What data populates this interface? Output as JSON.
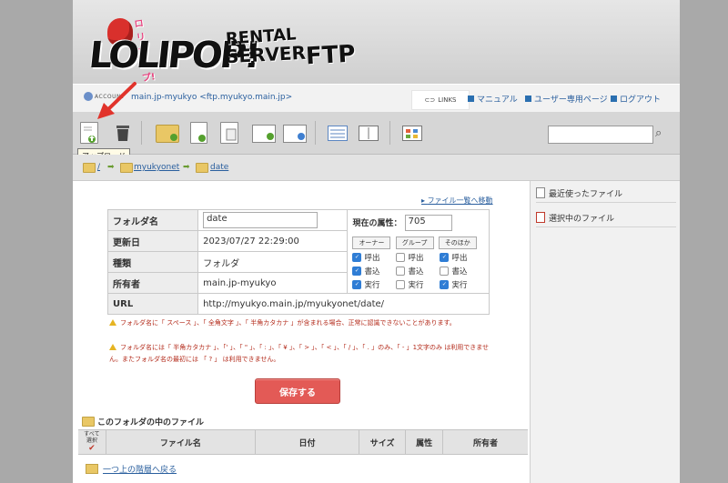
{
  "header": {
    "logo_tag": "ロリポップ!レンタルサーバー",
    "logo_main": "LOLIPOP!",
    "logo_rental": "RENTAL",
    "logo_server": "SERVER",
    "logo_ftp": "FTP"
  },
  "account": {
    "label": "ACCOUNT",
    "name": "main.jp-myukyo <ftp.myukyo.main.jp>",
    "links_label": "LINKS",
    "nav": [
      "マニュアル",
      "ユーザー専用ページ",
      "ログアウト"
    ]
  },
  "toolbar": {
    "tooltip": "アップロード",
    "search_value": ""
  },
  "breadcrumb": {
    "root": "/",
    "items": [
      "myukyonet",
      "date"
    ]
  },
  "main": {
    "filelist_link": "ファイル一覧へ移動",
    "props": {
      "folder_label": "フォルダ名",
      "folder_value": "date",
      "updated_label": "更新日",
      "updated_value": "2023/07/27 22:29:00",
      "type_label": "種類",
      "type_value": "フォルダ",
      "owner_label": "所有者",
      "owner_value": "main.jp-myukyo",
      "url_label": "URL",
      "url_value": "http://myukyo.main.jp/myukyonet/date/"
    },
    "perms": {
      "title": "現在の属性：",
      "value": "705",
      "heads": [
        "オーナー",
        "グループ",
        "そのほか"
      ],
      "rows": [
        {
          "label": "呼出",
          "checked": [
            true,
            false,
            true
          ]
        },
        {
          "label": "書込",
          "checked": [
            true,
            false,
            false
          ]
        },
        {
          "label": "実行",
          "checked": [
            true,
            false,
            true
          ]
        }
      ]
    },
    "warnings": [
      "フォルダ名に「 スペース 」、「 全角文字 」、「 半角カタカナ 」が含まれる場合、正常に認識できないことがあります。",
      "フォルダ名には「 半角カタカナ 」、「' 」、「 \" 」、「 : 」、「 ¥ 」、「 > 」、「 < 」、「 / 」、「 . 」のみ、「 - 」1文字のみ は利用できません。またフォルダ名の最初には 「 ? 」 は利用できません。"
    ],
    "save_label": "保存する",
    "infolder_title": "このフォルダの中のファイル",
    "list_heads": {
      "selectall": "すべて選択",
      "name": "ファイル名",
      "date": "日付",
      "size": "サイズ",
      "attr": "属性",
      "owner": "所有者"
    },
    "up_link": "一つ上の階層へ戻る"
  },
  "side": {
    "recent": "最近使ったファイル",
    "selected": "選択中のファイル"
  },
  "colors": {
    "accent_red": "#e35a56",
    "link_blue": "#2a5f9e",
    "checkbox_blue": "#2f7dd5"
  }
}
